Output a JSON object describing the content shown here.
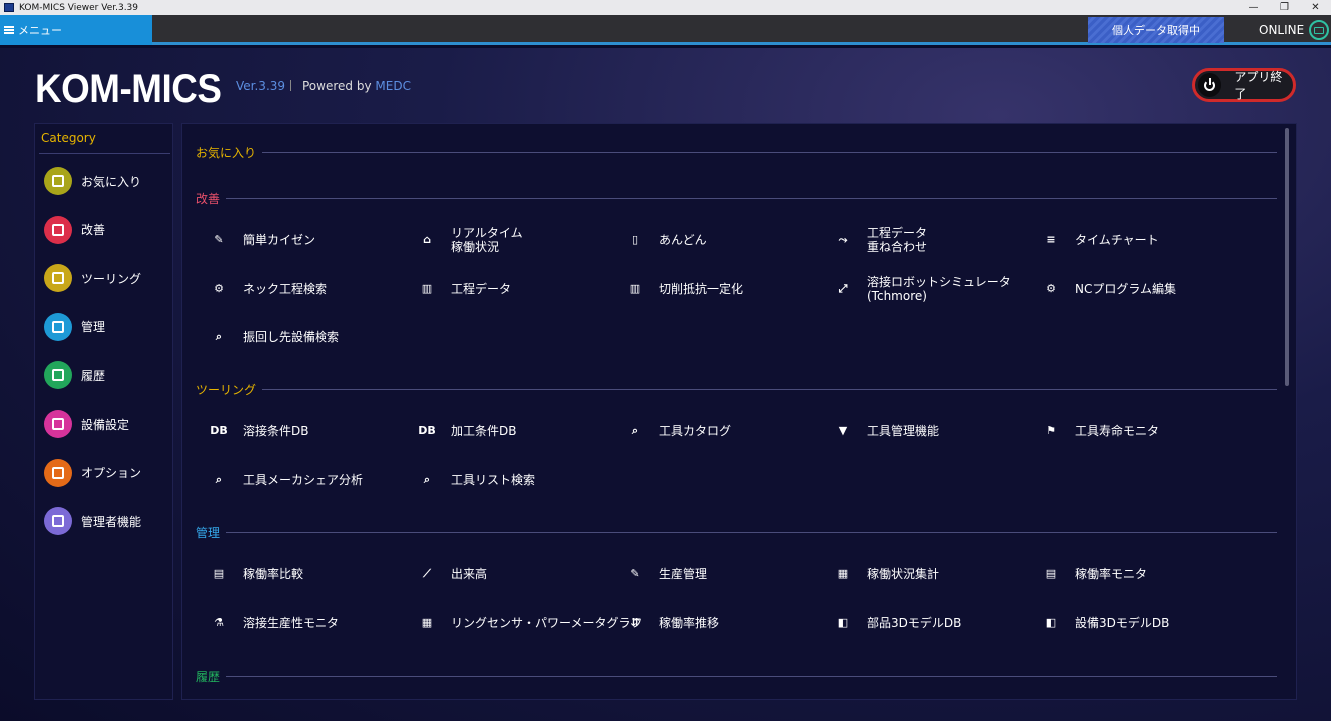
{
  "window": {
    "title": "KOM-MICS Viewer  Ver.3.39",
    "minimize": "—",
    "restore": "❐",
    "close": "✕"
  },
  "topbar": {
    "menu_label": "メニュー",
    "data_button": "個人データ取得中",
    "status": "ONLINE"
  },
  "header": {
    "logo": "KOM-MICS",
    "version": "Ver.3.39",
    "powered_by": "Powered by",
    "powered_brand": "MEDC",
    "quit_label": "アプリ終了"
  },
  "sidebar": {
    "title": "Category",
    "items": [
      {
        "label": "お気に入り",
        "icon": "favorite-icon",
        "color": "#a9a51a"
      },
      {
        "label": "改善",
        "icon": "kaizen-icon",
        "color": "#dc2f4a"
      },
      {
        "label": "ツーリング",
        "icon": "tooling-icon",
        "color": "#c9a71a"
      },
      {
        "label": "管理",
        "icon": "management-icon",
        "color": "#1e9ad6"
      },
      {
        "label": "履歴",
        "icon": "history-icon",
        "color": "#22a65b"
      },
      {
        "label": "設備設定",
        "icon": "equipment-settings-icon",
        "color": "#d6339b"
      },
      {
        "label": "オプション",
        "icon": "options-icon",
        "color": "#e46a18"
      },
      {
        "label": "管理者機能",
        "icon": "admin-icon",
        "color": "#7c6ad6"
      }
    ]
  },
  "sections": {
    "favorites": {
      "title": "お気に入り",
      "color": "#e6b400"
    },
    "kaizen": {
      "title": "改善",
      "color": "#e8506a",
      "tiles": [
        "簡単カイゼン",
        "リアルタイム\n稼働状況",
        "あんどん",
        "工程データ\n重ね合わせ",
        "タイムチャート",
        "ネック工程検索",
        "工程データ",
        "切削抵抗一定化",
        "溶接ロボットシミュレータ\n(Tchmore)",
        "NCプログラム編集",
        "振回し先設備検索"
      ]
    },
    "tooling": {
      "title": "ツーリング",
      "color": "#e6b400",
      "tiles": [
        "溶接条件DB",
        "加工条件DB",
        "工具カタログ",
        "工具管理機能",
        "工具寿命モニタ",
        "工具メーカシェア分析",
        "工具リスト検索"
      ]
    },
    "management": {
      "title": "管理",
      "color": "#35a8ea",
      "tiles": [
        "稼働率比較",
        "出来高",
        "生産管理",
        "稼働状況集計",
        "稼働率モニタ",
        "溶接生産性モニタ",
        "リングセンサ・パワーメータグラフ",
        "稼働率推移",
        "部品3DモデルDB",
        "設備3DモデルDB"
      ]
    },
    "history": {
      "title": "履歴",
      "color": "#22b45e"
    }
  }
}
